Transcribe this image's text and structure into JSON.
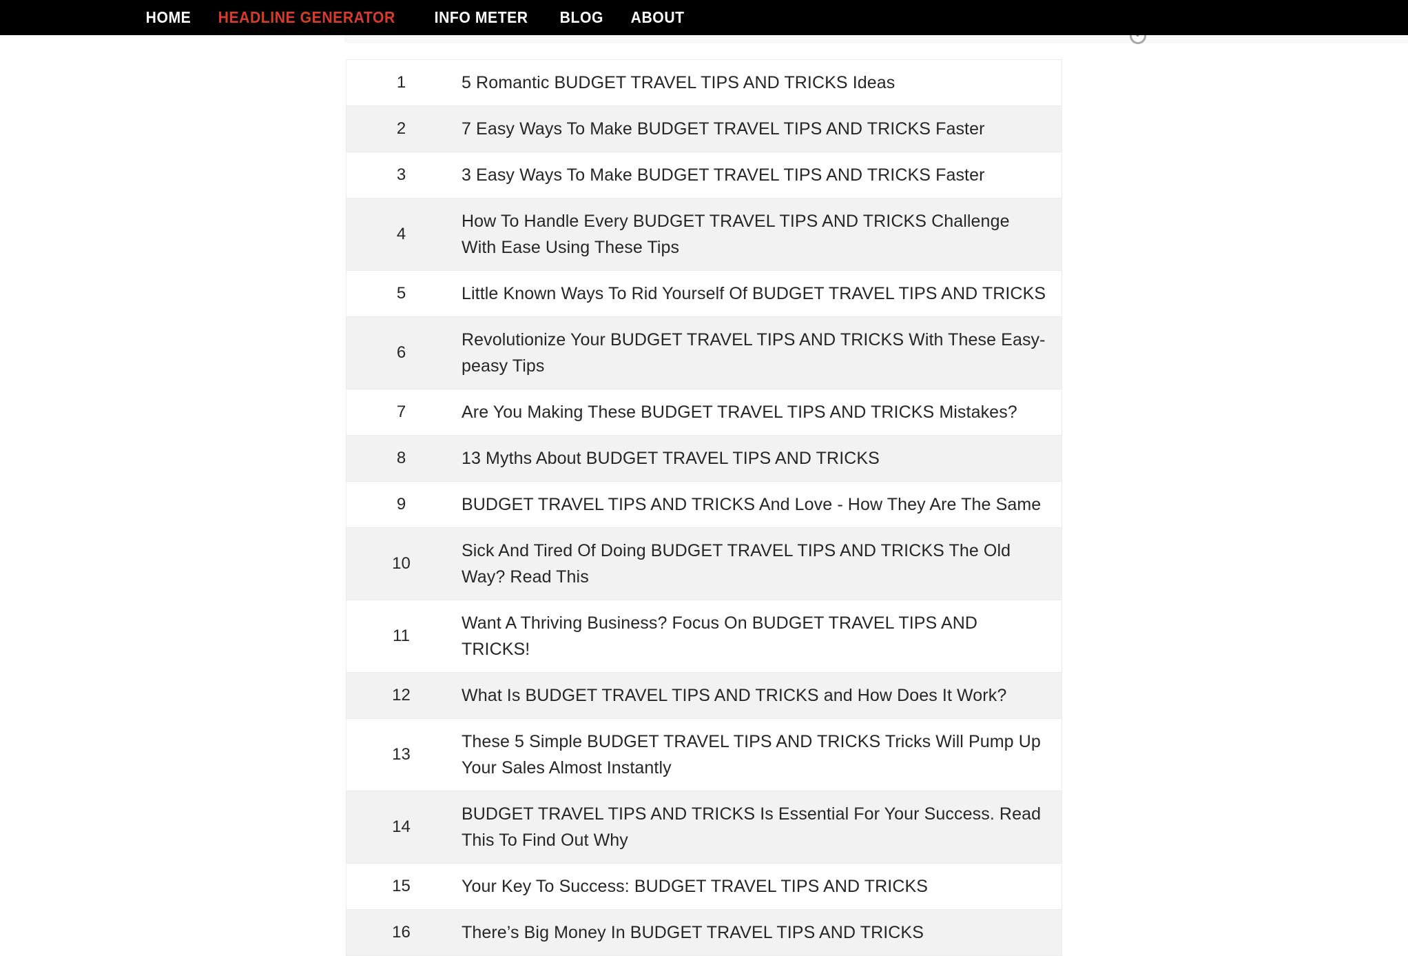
{
  "nav": {
    "items": [
      {
        "label": "HOME",
        "active": false
      },
      {
        "label": "HEADLINE GENERATOR",
        "active": true
      },
      {
        "label": "INFO METER",
        "active": false
      },
      {
        "label": "BLOG",
        "active": false
      },
      {
        "label": "ABOUT",
        "active": false
      }
    ],
    "background_color": "#000000",
    "text_color": "#ffffff",
    "active_color": "#d93b2b"
  },
  "icons": {
    "clip_icon": "info-circle-icon"
  },
  "table": {
    "keyword": "BUDGET TRAVEL TIPS AND TRICKS",
    "row_bg": "#ffffff",
    "row_alt_bg": "#f2f2f2",
    "border_color": "#ebebeb",
    "rows": [
      {
        "num": "1",
        "headline": "5 Romantic BUDGET TRAVEL TIPS AND TRICKS Ideas"
      },
      {
        "num": "2",
        "headline": "7 Easy Ways To Make BUDGET TRAVEL TIPS AND TRICKS Faster"
      },
      {
        "num": "3",
        "headline": "3 Easy Ways To Make BUDGET TRAVEL TIPS AND TRICKS Faster"
      },
      {
        "num": "4",
        "headline": "How To Handle Every BUDGET TRAVEL TIPS AND TRICKS Challenge With Ease Using These Tips"
      },
      {
        "num": "5",
        "headline": "Little Known Ways To Rid Yourself Of BUDGET TRAVEL TIPS AND TRICKS"
      },
      {
        "num": "6",
        "headline": "Revolutionize Your BUDGET TRAVEL TIPS AND TRICKS With These Easy-peasy Tips"
      },
      {
        "num": "7",
        "headline": "Are You Making These BUDGET TRAVEL TIPS AND TRICKS Mistakes?"
      },
      {
        "num": "8",
        "headline": "13 Myths About BUDGET TRAVEL TIPS AND TRICKS"
      },
      {
        "num": "9",
        "headline": "BUDGET TRAVEL TIPS AND TRICKS And Love - How They Are The Same"
      },
      {
        "num": "10",
        "headline": "Sick And Tired Of Doing BUDGET TRAVEL TIPS AND TRICKS The Old Way? Read This"
      },
      {
        "num": "11",
        "headline": "Want A Thriving Business? Focus On BUDGET TRAVEL TIPS AND TRICKS!"
      },
      {
        "num": "12",
        "headline": "What Is BUDGET TRAVEL TIPS AND TRICKS and How Does It Work?"
      },
      {
        "num": "13",
        "headline": "These 5 Simple BUDGET TRAVEL TIPS AND TRICKS Tricks Will Pump Up Your Sales Almost Instantly"
      },
      {
        "num": "14",
        "headline": "BUDGET TRAVEL TIPS AND TRICKS Is Essential For Your Success. Read This To Find Out Why"
      },
      {
        "num": "15",
        "headline": "Your Key To Success: BUDGET TRAVEL TIPS AND TRICKS"
      },
      {
        "num": "16",
        "headline": "There’s Big Money In BUDGET TRAVEL TIPS AND TRICKS"
      }
    ]
  }
}
